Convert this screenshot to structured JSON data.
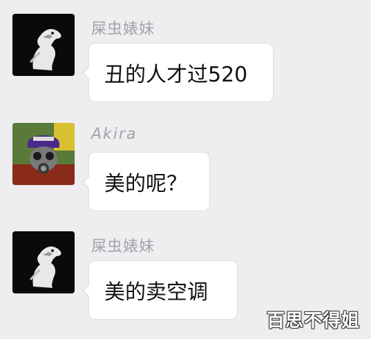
{
  "chat": {
    "messages": [
      {
        "sender": "屎虫婊妹",
        "text": "丑的人才过520",
        "avatar": "dinosaur-avatar-icon"
      },
      {
        "sender": "Akira",
        "text": "美的呢？",
        "avatar": "gas-mask-avatar-icon"
      },
      {
        "sender": "屎虫婊妹",
        "text": "美的卖空调",
        "avatar": "dinosaur-avatar-icon"
      }
    ]
  },
  "watermark": "百思不得姐",
  "colors": {
    "background": "#eeedf0",
    "bubble": "#ffffff",
    "sender_text": "#a3a3a8",
    "message_text": "#111111"
  }
}
